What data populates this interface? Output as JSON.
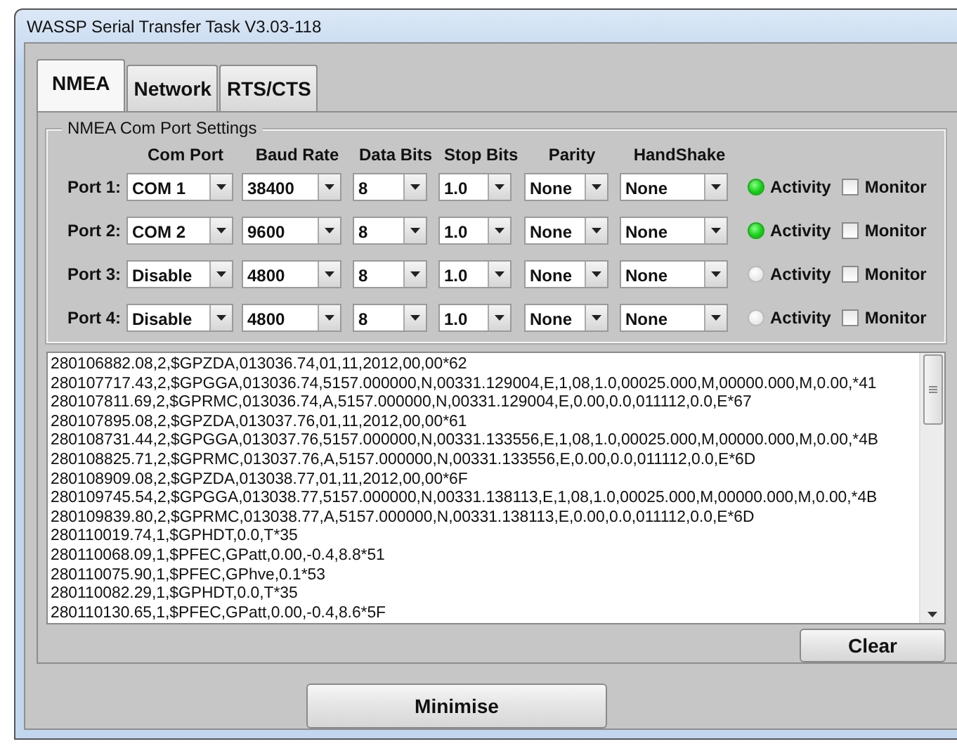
{
  "window": {
    "title": "WASSP Serial Transfer Task V3.03-118"
  },
  "tabs": [
    {
      "label": "NMEA",
      "selected": true
    },
    {
      "label": "Network",
      "selected": false
    },
    {
      "label": "RTS/CTS",
      "selected": false
    }
  ],
  "group": {
    "title": "NMEA Com Port Settings",
    "columns": [
      "Com Port",
      "Baud Rate",
      "Data Bits",
      "Stop Bits",
      "Parity",
      "HandShake"
    ],
    "ports": [
      {
        "label": "Port 1:",
        "values": [
          "COM 1",
          "38400",
          "8",
          "1.0",
          "None",
          "None"
        ],
        "activity": {
          "label": "Activity",
          "on": true
        },
        "monitor": {
          "label": "Monitor",
          "checked": false
        }
      },
      {
        "label": "Port 2:",
        "values": [
          "COM 2",
          "9600",
          "8",
          "1.0",
          "None",
          "None"
        ],
        "activity": {
          "label": "Activity",
          "on": true
        },
        "monitor": {
          "label": "Monitor",
          "checked": false
        }
      },
      {
        "label": "Port 3:",
        "values": [
          "Disable",
          "4800",
          "8",
          "1.0",
          "None",
          "None"
        ],
        "activity": {
          "label": "Activity",
          "on": false
        },
        "monitor": {
          "label": "Monitor",
          "checked": false
        }
      },
      {
        "label": "Port 4:",
        "values": [
          "Disable",
          "4800",
          "8",
          "1.0",
          "None",
          "None"
        ],
        "activity": {
          "label": "Activity",
          "on": false
        },
        "monitor": {
          "label": "Monitor",
          "checked": false
        }
      }
    ]
  },
  "log": [
    "280106882.08,2,$GPZDA,013036.74,01,11,2012,00,00*62",
    "280107717.43,2,$GPGGA,013036.74,5157.000000,N,00331.129004,E,1,08,1.0,00025.000,M,00000.000,M,0.00,*41",
    "280107811.69,2,$GPRMC,013036.74,A,5157.000000,N,00331.129004,E,0.00,0.0,011112,0.0,E*67",
    "280107895.08,2,$GPZDA,013037.76,01,11,2012,00,00*61",
    "280108731.44,2,$GPGGA,013037.76,5157.000000,N,00331.133556,E,1,08,1.0,00025.000,M,00000.000,M,0.00,*4B",
    "280108825.71,2,$GPRMC,013037.76,A,5157.000000,N,00331.133556,E,0.00,0.0,011112,0.0,E*6D",
    "280108909.08,2,$GPZDA,013038.77,01,11,2012,00,00*6F",
    "280109745.54,2,$GPGGA,013038.77,5157.000000,N,00331.138113,E,1,08,1.0,00025.000,M,00000.000,M,0.00,*4B",
    "280109839.80,2,$GPRMC,013038.77,A,5157.000000,N,00331.138113,E,0.00,0.0,011112,0.0,E*6D",
    "280110019.74,1,$GPHDT,0.0,T*35",
    "280110068.09,1,$PFEC,GPatt,0.00,-0.4,8.8*51",
    "280110075.90,1,$PFEC,GPhve,0.1*53",
    "280110082.29,1,$GPHDT,0.0,T*35",
    "280110130.65,1,$PFEC,GPatt,0.00,-0.4,8.6*5F"
  ],
  "buttons": {
    "clear": "Clear",
    "minimise": "Minimise"
  }
}
